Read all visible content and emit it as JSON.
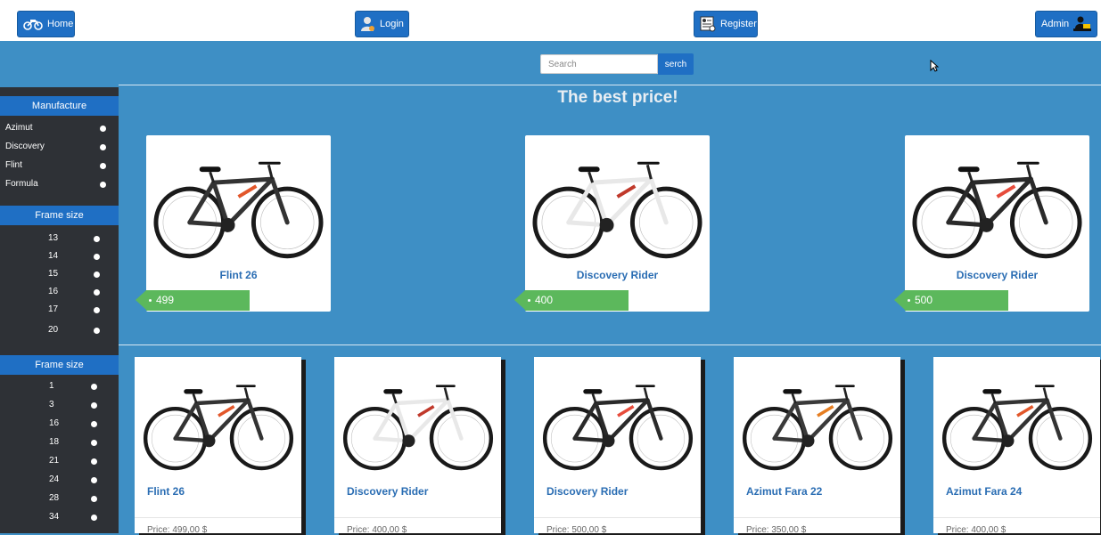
{
  "nav": {
    "home_label": "Home",
    "login_label": "Login",
    "register_label": "Register",
    "admin_label": "Admin"
  },
  "search": {
    "placeholder": "Search",
    "button_label": "serch"
  },
  "headline": "The best price!",
  "sidebar": {
    "manufacture": {
      "title": "Manufacture",
      "items": [
        "Azimut",
        "Discovery",
        "Flint",
        "Formula"
      ]
    },
    "frame_size_1": {
      "title": "Frame size",
      "items": [
        "13",
        "14",
        "15",
        "16",
        "17",
        "20"
      ]
    },
    "frame_size_2": {
      "title": "Frame size",
      "items": [
        "1",
        "3",
        "16",
        "18",
        "21",
        "24",
        "28",
        "34"
      ]
    }
  },
  "featured": [
    {
      "title": "Flint 26",
      "price": "499",
      "bike_color": "#333333",
      "accent": "#e2572b"
    },
    {
      "title": "Discovery Rider",
      "price": "400",
      "bike_color": "#e8e8e8",
      "accent": "#c0392b"
    },
    {
      "title": "Discovery Rider",
      "price": "500",
      "bike_color": "#2a2a2a",
      "accent": "#e74c3c"
    }
  ],
  "products": [
    {
      "title": "Flint 26",
      "price": "Price: 499,00 $",
      "bike_color": "#333333",
      "accent": "#e2572b"
    },
    {
      "title": "Discovery Rider",
      "price": "Price: 400,00 $",
      "bike_color": "#e8e8e8",
      "accent": "#c0392b"
    },
    {
      "title": "Discovery Rider",
      "price": "Price: 500,00 $",
      "bike_color": "#2a2a2a",
      "accent": "#e74c3c"
    },
    {
      "title": "Azimut Fara 22",
      "price": "Price: 350,00 $",
      "bike_color": "#3a3a3a",
      "accent": "#e67e22"
    },
    {
      "title": "Azimut Fara 24",
      "price": "Price: 400,00 $",
      "bike_color": "#333333",
      "accent": "#e2572b"
    }
  ],
  "colors": {
    "page_bg": "#3e8fc5",
    "primary": "#1f6fc4",
    "sidebar_bg": "#2e3136",
    "price_tag": "#5cb85c",
    "title_text": "#2a6db3"
  }
}
